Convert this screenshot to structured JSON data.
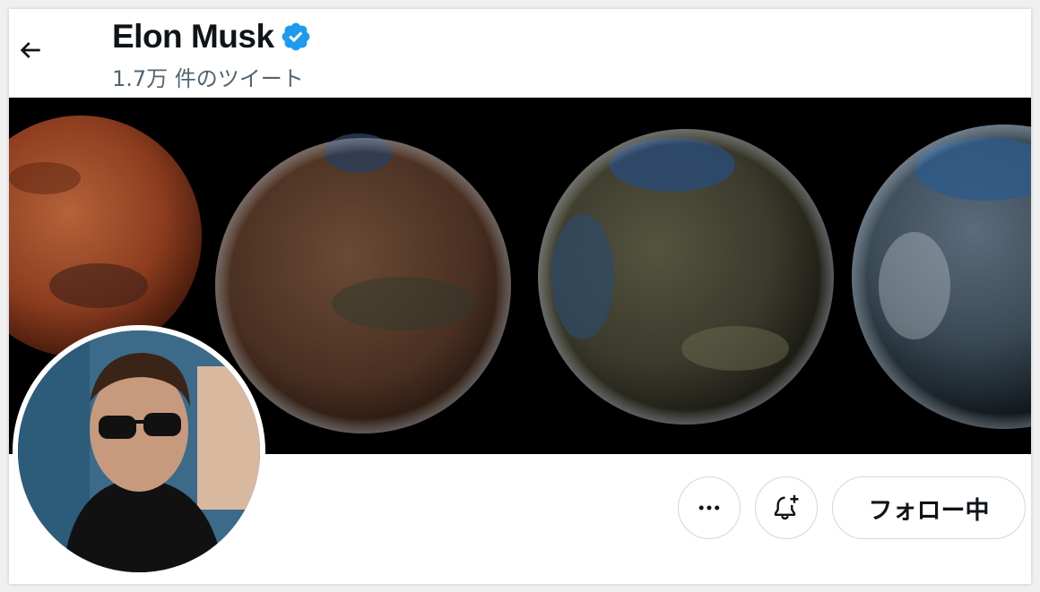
{
  "header": {
    "back_icon": "arrow-left-icon",
    "name": "Elon Musk",
    "verified_icon": "verified-badge-icon",
    "tweet_count": "1.7万 件のツイート"
  },
  "banner": {
    "image": "mars-terraforming-banner"
  },
  "avatar": {
    "image": "profile-photo"
  },
  "actions": {
    "more_icon": "more-horizontal-icon",
    "notify_icon": "bell-plus-icon",
    "follow_label": "フォロー中"
  },
  "colors": {
    "verified": "#1d9bf0",
    "text_primary": "#0f1419",
    "text_secondary": "#536471",
    "border": "#cfd9de"
  }
}
